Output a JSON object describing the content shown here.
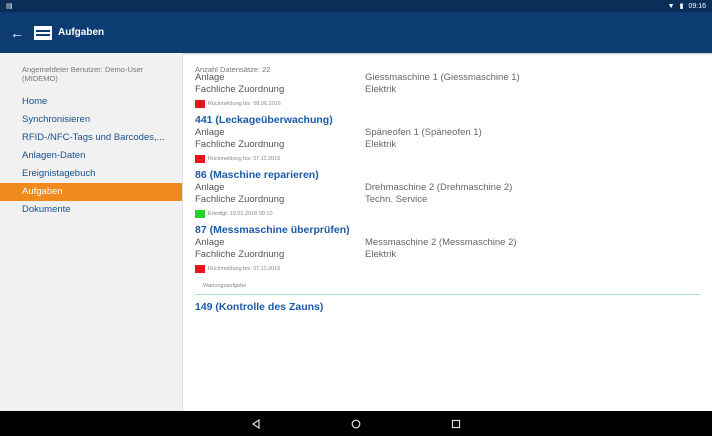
{
  "statusbar": {
    "time": "09:16"
  },
  "appbar": {
    "back_icon": "arrow-left-icon",
    "title": "Aufgaben"
  },
  "sidebar": {
    "user": "Angemeldeter Benutzer: Demo-User (MIDEMO)",
    "items": [
      {
        "label": "Home"
      },
      {
        "label": "Synchronisieren"
      },
      {
        "label": "RFID-/NFC-Tags und Barcodes,..."
      },
      {
        "label": "Anlagen-Daten"
      },
      {
        "label": "Ereignistagebuch"
      },
      {
        "label": "Aufgaben",
        "active": true
      },
      {
        "label": "Dokumente"
      }
    ]
  },
  "content": {
    "count": "Anzahl Datensätze: 22",
    "first": {
      "anlage_label": "Anlage",
      "anlage_value": "Giessmaschine 1 (Giessmaschine 1)",
      "zuordnung_label": "Fachliche Zuordnung",
      "zuordnung_value": "Elektrik",
      "status": "Rückmeldung bis: 08.06.2016",
      "status_color": "#e8141c"
    },
    "tasks": [
      {
        "title": "441 (Leckageüberwachung)",
        "anlage_label": "Anlage",
        "anlage_value": "Späneofen 1 (Späneofen 1)",
        "zuordnung_label": "Fachliche Zuordnung",
        "zuordnung_value": "Elektrik",
        "status": "Rückmeldung bis: 07.11.2015",
        "status_color": "#e8141c"
      },
      {
        "title": "86 (Maschine reparieren)",
        "anlage_label": "Anlage",
        "anlage_value": "Drehmaschine 2 (Drehmaschine 2)",
        "zuordnung_label": "Fachliche Zuordnung",
        "zuordnung_value": "Techn. Service",
        "status": "Erledigt: 19.01.2018 09:10",
        "status_color": "#26d02a"
      },
      {
        "title": "87 (Messmaschine überprüfen)",
        "anlage_label": "Anlage",
        "anlage_value": "Messmaschine 2 (Messmaschine 2)",
        "zuordnung_label": "Fachliche Zuordnung",
        "zuordnung_value": "Elektrik",
        "status": "Rückmeldung bis: 07.11.2015",
        "status_color": "#e8141c"
      }
    ],
    "subtype": "Wartungsaufgabe",
    "last_title": "149 (Kontrolle des Zauns)"
  },
  "navbar": {
    "back": "back-triangle-icon",
    "home": "home-circle-icon",
    "recents": "recents-square-icon"
  }
}
